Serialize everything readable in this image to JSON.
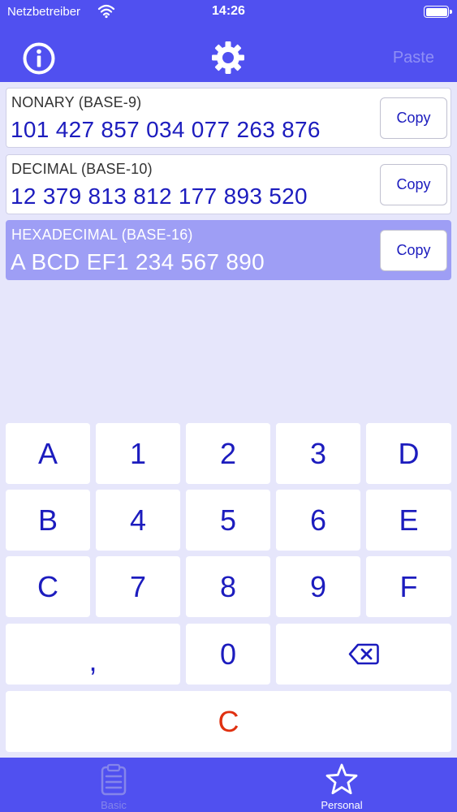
{
  "status_bar": {
    "carrier": "Netzbetreiber",
    "time": "14:26"
  },
  "nav": {
    "info_icon": "info-icon",
    "settings_icon": "gear-icon",
    "paste_label": "Paste"
  },
  "results": [
    {
      "label": "NONARY (BASE-9)",
      "value": "101 427 857 034 077 263 876",
      "copy_label": "Copy",
      "selected": false
    },
    {
      "label": "DECIMAL (BASE-10)",
      "value": "12 379 813 812 177 893 520",
      "copy_label": "Copy",
      "selected": false
    },
    {
      "label": "HEXADECIMAL (BASE-16)",
      "value": "A BCD EF1 234 567 890",
      "copy_label": "Copy",
      "selected": true
    }
  ],
  "keypad": {
    "row1": [
      "A",
      "1",
      "2",
      "3",
      "D"
    ],
    "row2": [
      "B",
      "4",
      "5",
      "6",
      "E"
    ],
    "row3": [
      "C",
      "7",
      "8",
      "9",
      "F"
    ],
    "separator": ",",
    "zero": "0",
    "backspace_icon": "backspace-icon",
    "clear": "C"
  },
  "tabs": [
    {
      "label": "Basic",
      "icon": "clipboard-icon",
      "active": false
    },
    {
      "label": "Personal",
      "icon": "star-icon",
      "active": true
    }
  ],
  "colors": {
    "accent": "#5050f0",
    "selected_row": "#9e9ef5",
    "key_text": "#1c1cbe",
    "clear_key": "#e03010",
    "background": "#e6e6fb"
  }
}
